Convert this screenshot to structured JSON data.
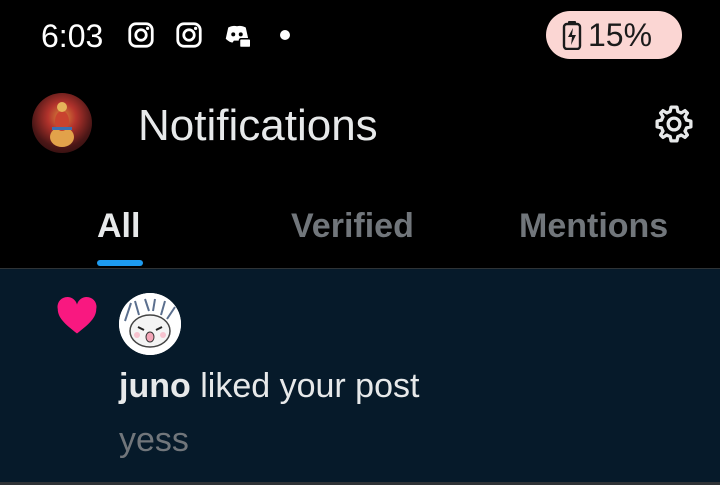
{
  "status_bar": {
    "time": "6:03",
    "icons": [
      "instagram-icon",
      "instagram-icon",
      "discord-icon",
      "notification-dot"
    ],
    "battery_text": "15%",
    "battery_level": 0.15,
    "battery_pill_color": "#fbd6d3"
  },
  "header": {
    "title": "Notifications",
    "settings_icon": "gear-icon"
  },
  "tabs": [
    {
      "label": "All",
      "active": true
    },
    {
      "label": "Verified",
      "active": false
    },
    {
      "label": "Mentions",
      "active": false
    }
  ],
  "notification": {
    "type_icon": "heart-icon",
    "user": "juno",
    "action": "liked your post",
    "preview": "yess"
  },
  "colors": {
    "accent": "#1d9bf0",
    "like": "#f91880",
    "background": "#000000",
    "unread_row": "#061a2a",
    "muted_text": "#71767b"
  }
}
